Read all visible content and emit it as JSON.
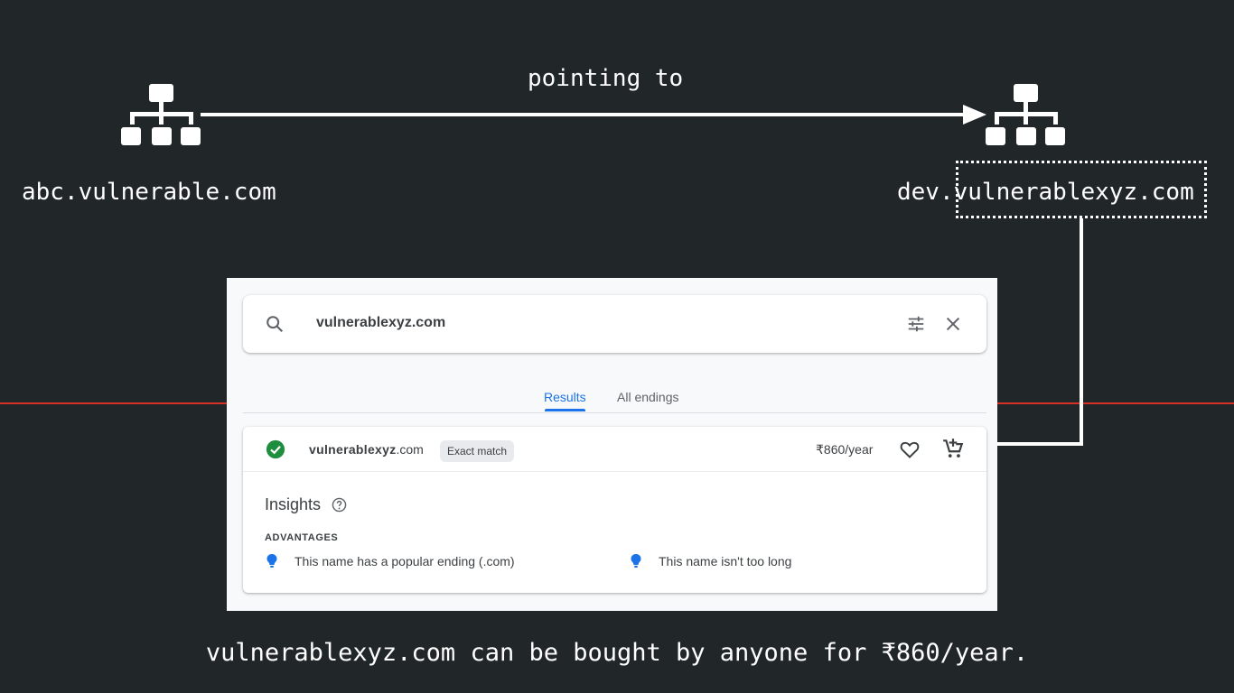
{
  "diagram": {
    "edge_label": "pointing to",
    "source_node": {
      "label": "abc.vulnerable.com",
      "icon": "network-hierarchy-icon"
    },
    "target_node": {
      "label": "dev.vulnerablexyz.com",
      "icon": "network-hierarchy-icon"
    },
    "caption": "vulnerablexyz.com can be bought by anyone for ₹860/year."
  },
  "domain_search": {
    "query": "vulnerablexyz.com",
    "tabs": [
      {
        "label": "Results",
        "active": true
      },
      {
        "label": "All endings",
        "active": false
      }
    ],
    "result": {
      "name": "vulnerablexyz",
      "tld": ".com",
      "badge": "Exact match",
      "price": "₹860/year",
      "status_icon": "check-circle-icon"
    },
    "insights": {
      "title": "Insights",
      "advantages_title": "ADVANTAGES",
      "advantages": [
        "This name has a popular ending (.com)",
        "This name isn't too long"
      ]
    }
  },
  "colors": {
    "background": "#212629",
    "accent": "#1a73e8",
    "success": "#1e8e3e",
    "divider_red": "#d93025"
  }
}
